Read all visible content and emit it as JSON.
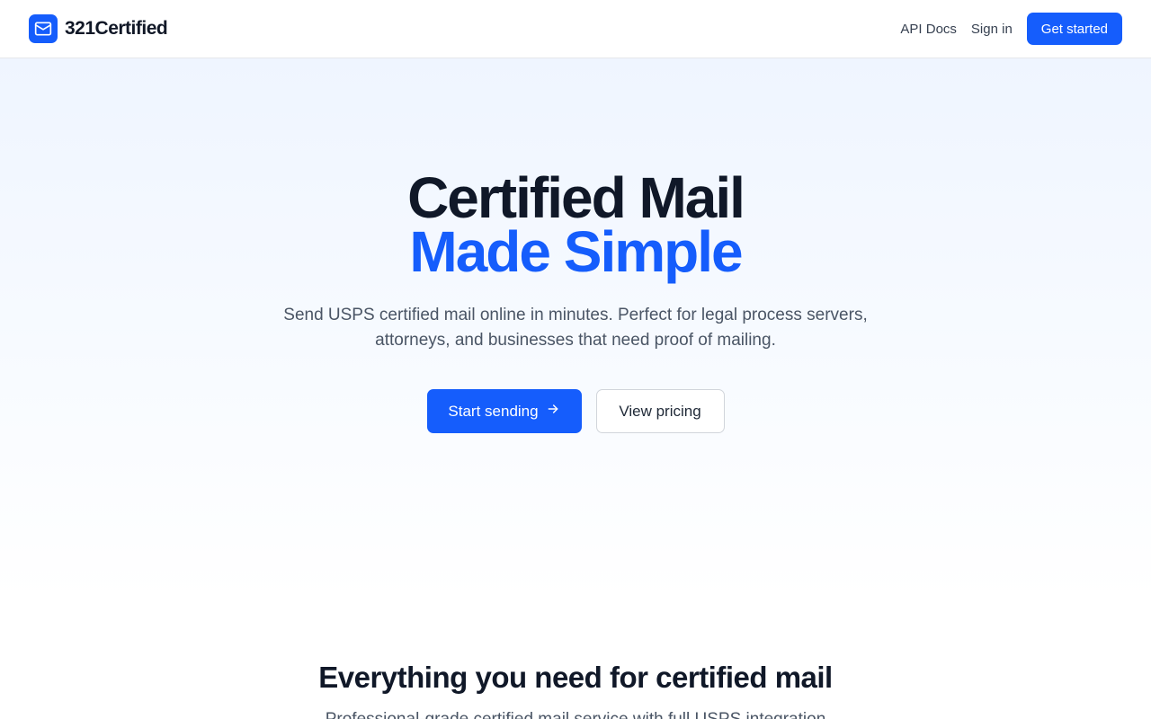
{
  "nav": {
    "brand": "321Certified",
    "links": [
      "API Docs",
      "Sign in"
    ],
    "cta": "Get started"
  },
  "hero": {
    "title_line1": "Certified Mail",
    "title_line2": "Made Simple",
    "subtitle": "Send USPS certified mail online in minutes. Perfect for legal process servers, attorneys, and businesses that need proof of mailing.",
    "primary_button": "Start sending",
    "secondary_button": "View pricing"
  },
  "features": {
    "title": "Everything you need for certified mail",
    "subtitle": "Professional-grade certified mail service with full USPS integration"
  },
  "icons": {
    "logo": "mail-icon",
    "arrow": "arrow-right-icon"
  },
  "colors": {
    "accent": "#155dfc",
    "heading": "#101828",
    "body_text": "#4a5565"
  }
}
